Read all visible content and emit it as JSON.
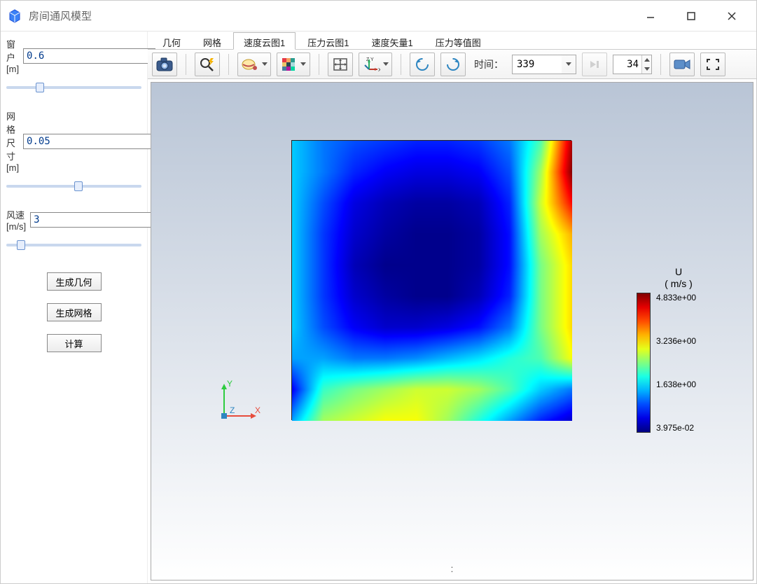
{
  "window": {
    "title": "房间通风模型"
  },
  "sidebar": {
    "window_label": "窗户[m]",
    "window_value": "0.6",
    "mesh_label": "网格尺寸[m]",
    "mesh_value": "0.05",
    "wind_label": "风速[m/s]",
    "wind_value": "3",
    "btn_geom": "生成几何",
    "btn_mesh": "生成网格",
    "btn_calc": "计算"
  },
  "tabs": {
    "geom": "几何",
    "mesh": "网格",
    "vel_cloud": "速度云图1",
    "press_cloud": "压力云图1",
    "vel_vec": "速度矢量1",
    "press_iso": "压力等值图"
  },
  "toolbar": {
    "time_label": "时间：",
    "time_value": "339",
    "frame_value": "34"
  },
  "icons": {
    "screenshot": "screenshot-icon",
    "zoom_select": "zoom-bolt-icon",
    "clip": "clip-icon",
    "colormap": "colormap-icon",
    "fit": "fit-view-icon",
    "axes": "axes-xyz-icon",
    "rot_ccw": "rotate-ccw-icon",
    "rot_cw": "rotate-cw-icon",
    "play_last": "play-last-icon",
    "camera": "video-camera-icon",
    "fullscreen": "fullscreen-icon"
  },
  "legend": {
    "title_line1": "U",
    "title_line2": "( m/s )",
    "max": "4.833e+00",
    "t2": "3.236e+00",
    "t3": "1.638e+00",
    "min": "3.975e-02"
  },
  "axes_triad": {
    "x": "X",
    "y": "Y",
    "z": "Z"
  },
  "chart_data": {
    "type": "heatmap",
    "title": "U ( m/s )",
    "xlabel": "X",
    "ylabel": "Y",
    "colorbar_label": "U (m/s)",
    "value_range": [
      0.03975,
      4.833
    ],
    "colormap": "jet",
    "grid": [
      [
        1.6,
        1.2,
        1.0,
        0.9,
        0.8,
        0.8,
        0.9,
        1.2,
        2.2,
        4.6
      ],
      [
        1.6,
        1.2,
        0.8,
        0.6,
        0.5,
        0.5,
        0.6,
        1.0,
        2.6,
        4.8
      ],
      [
        1.6,
        1.0,
        0.5,
        0.3,
        0.2,
        0.2,
        0.3,
        0.8,
        2.8,
        4.2
      ],
      [
        1.6,
        0.9,
        0.4,
        0.2,
        0.1,
        0.1,
        0.2,
        0.7,
        2.6,
        3.4
      ],
      [
        1.6,
        0.9,
        0.3,
        0.1,
        0.1,
        0.1,
        0.2,
        0.7,
        2.4,
        3.2
      ],
      [
        1.6,
        0.9,
        0.4,
        0.2,
        0.1,
        0.1,
        0.3,
        0.8,
        2.4,
        3.2
      ],
      [
        1.6,
        1.0,
        0.6,
        0.4,
        0.4,
        0.5,
        0.7,
        1.2,
        2.4,
        3.2
      ],
      [
        1.4,
        1.4,
        1.2,
        1.2,
        1.3,
        1.5,
        1.7,
        2.0,
        2.2,
        3.0
      ],
      [
        0.6,
        2.1,
        2.4,
        2.6,
        2.8,
        2.8,
        2.6,
        2.2,
        1.6,
        1.2
      ],
      [
        1.4,
        2.6,
        2.8,
        3.0,
        3.0,
        2.6,
        2.0,
        1.4,
        0.8,
        0.4
      ]
    ],
    "grid_orientation": "row0_is_top"
  }
}
